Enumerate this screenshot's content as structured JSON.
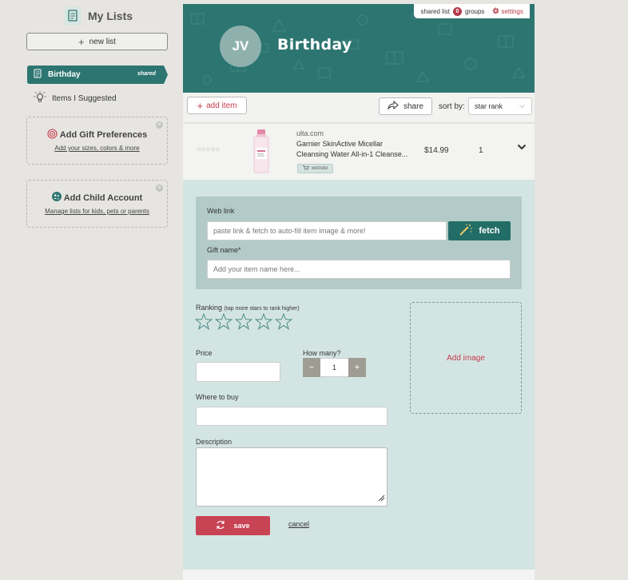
{
  "sidebar": {
    "title": "My Lists",
    "new_list_label": "new list",
    "items": [
      {
        "label": "Birthday",
        "badge": "shared",
        "active": true,
        "icon": "list-icon"
      },
      {
        "label": "Items I Suggested",
        "active": false,
        "icon": "lightbulb-icon"
      }
    ],
    "promos": [
      {
        "title": "Add Gift Preferences",
        "subtitle": "Add your sizes, colors & more",
        "icon": "target-icon"
      },
      {
        "title": "Add Child Account",
        "subtitle": "Manage lists for kids, pets or parents",
        "icon": "child-icon"
      }
    ]
  },
  "header": {
    "shared_list_label": "shared list",
    "groups_count": "0",
    "groups_label": "groups",
    "settings_label": "settings",
    "avatar_initials": "JV",
    "list_title": "Birthday"
  },
  "toolbar": {
    "add_item_label": "add item",
    "share_label": "share",
    "sort_label": "sort by:",
    "sort_value": "star rank"
  },
  "item": {
    "store": "ulta.com",
    "name": "Garnier SkinActive Micellar Cleansing Water All-in-1 Cleanse...",
    "website_label": "website",
    "price": "$14.99",
    "quantity": "1",
    "stars": "☆☆☆☆☆"
  },
  "form": {
    "web_link_label": "Web link",
    "web_link_placeholder": "paste link & fetch to auto-fill item image & more!",
    "fetch_label": "fetch",
    "gift_name_label": "Gift name*",
    "gift_name_placeholder": "Add your item name here...",
    "ranking_label": "Ranking",
    "ranking_hint": "(tap more stars to rank higher)",
    "ranking_value": 0,
    "price_label": "Price",
    "how_many_label": "How many?",
    "how_many_value": "1",
    "minus": "−",
    "plus": "+",
    "where_label": "Where to buy",
    "description_label": "Description",
    "add_image_label": "Add image",
    "save_label": "save",
    "cancel_label": "cancel"
  },
  "colors": {
    "teal": "#2d7571",
    "teal_dark": "#236d67",
    "accent_red": "#c84353",
    "panel": "#d3e5e3"
  }
}
